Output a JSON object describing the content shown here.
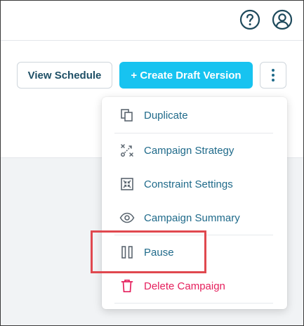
{
  "header": {
    "help_icon": "help-circle-icon",
    "account_icon": "account-circle-icon"
  },
  "toolbar": {
    "view_schedule_label": "View Schedule",
    "create_draft_label": "+ Create Draft Version",
    "more_icon": "more-vertical-icon"
  },
  "menu": {
    "items": [
      {
        "label": "Duplicate",
        "icon": "duplicate-icon"
      },
      {
        "label": "Campaign Strategy",
        "icon": "strategy-icon"
      },
      {
        "label": "Constraint Settings",
        "icon": "constraint-icon"
      },
      {
        "label": "Campaign Summary",
        "icon": "eye-icon"
      },
      {
        "label": "Pause",
        "icon": "pause-icon"
      },
      {
        "label": "Delete Campaign",
        "icon": "trash-icon"
      }
    ]
  },
  "colors": {
    "primary": "#17c3f0",
    "text_link": "#1f6a8a",
    "danger": "#e5205d",
    "highlight": "#e0484f"
  }
}
